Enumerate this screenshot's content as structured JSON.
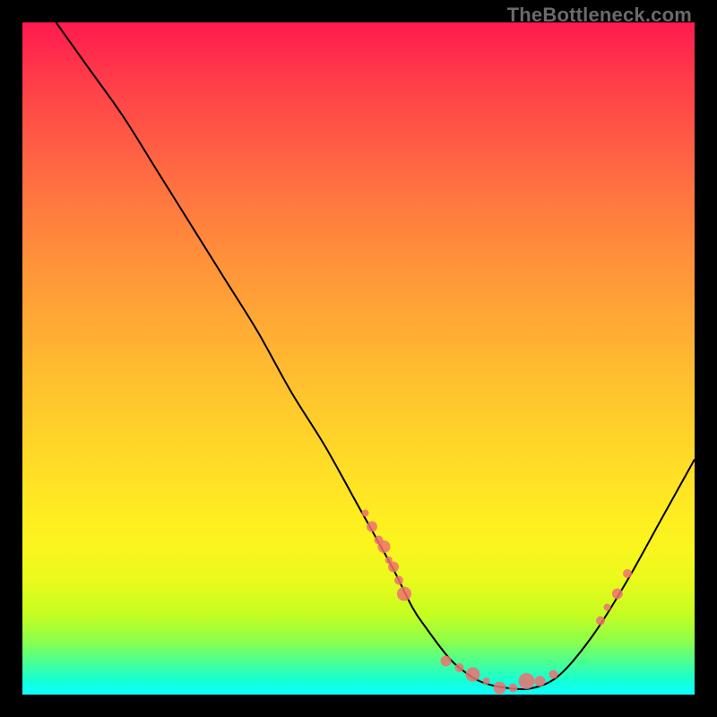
{
  "watermark": "TheBottleneck.com",
  "chart_data": {
    "type": "line",
    "title": "",
    "xlabel": "",
    "ylabel": "",
    "xlim": [
      0,
      100
    ],
    "ylim": [
      0,
      100
    ],
    "background": "red-yellow-green vertical gradient (bottleneck heatmap)",
    "curve": {
      "name": "bottleneck-curve",
      "x": [
        5,
        10,
        15,
        20,
        25,
        30,
        35,
        40,
        45,
        50,
        55,
        58,
        60,
        63,
        65,
        68,
        72,
        76,
        80,
        85,
        90,
        95,
        100
      ],
      "y": [
        100,
        93,
        86,
        78,
        70,
        62,
        54,
        45,
        37,
        28,
        19,
        13,
        10,
        6,
        4,
        2,
        1,
        1,
        3,
        9,
        17,
        26,
        35
      ]
    },
    "series": [
      {
        "name": "markers-left-arm",
        "x": [
          51,
          52,
          53,
          53.8,
          54.5,
          55.2,
          56,
          56.8
        ],
        "y": [
          27,
          25,
          23,
          22,
          20,
          19,
          17,
          15
        ],
        "marker": "circle",
        "size_hint": "mixed-small"
      },
      {
        "name": "markers-valley",
        "x": [
          63,
          65,
          67,
          69,
          71,
          73,
          75,
          77,
          79
        ],
        "y": [
          5,
          4,
          3,
          2,
          1,
          1,
          2,
          2,
          3
        ],
        "marker": "circle",
        "size_hint": "mixed"
      },
      {
        "name": "markers-right-arm",
        "x": [
          86,
          87,
          88.5,
          90
        ],
        "y": [
          11,
          13,
          15,
          18
        ],
        "marker": "circle",
        "size_hint": "small"
      }
    ],
    "colors": {
      "curve": "#000000",
      "marker": "#f07070"
    }
  }
}
